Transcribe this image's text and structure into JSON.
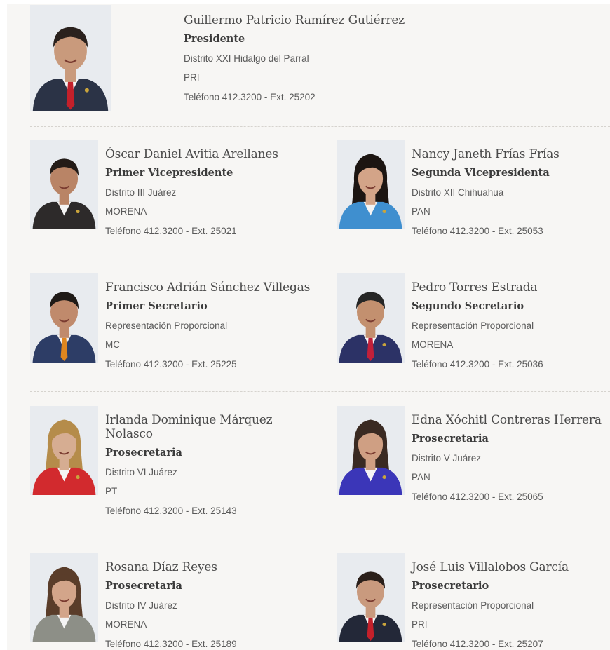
{
  "members": [
    {
      "name": "Guillermo Patricio Ramírez Gutiérrez",
      "role": "Presidente",
      "district": "Distrito XXI Hidalgo del Parral",
      "party": "PRI",
      "phone": "Teléfono 412.3200  -  Ext. 25202",
      "skin": "#c99a7c",
      "hair": "#2a211d",
      "suit": "#2b3346",
      "tie": "#c4202a",
      "gender": "m",
      "pin": true
    },
    {
      "name": "Óscar Daniel Avitia Arellanes",
      "role": "Primer Vicepresidente",
      "district": "Distrito III Juárez",
      "party": "MORENA",
      "phone": "Teléfono 412.3200  -  Ext. 25021",
      "skin": "#b98466",
      "hair": "#231b17",
      "suit": "#2d2a2a",
      "tie": "",
      "gender": "m",
      "pin": true
    },
    {
      "name": "Nancy Janeth Frías Frías",
      "role": "Segunda Vicepresidenta",
      "district": "Distrito XII Chihuahua",
      "party": "PAN",
      "phone": "Teléfono 412.3200  -  Ext. 25053",
      "skin": "#d3a488",
      "hair": "#1c1512",
      "suit": "#3f8fcf",
      "tie": "",
      "gender": "f",
      "pin": true
    },
    {
      "name": "Francisco Adrián Sánchez Villegas",
      "role": "Primer Secretario",
      "district": "Representación Proporcional",
      "party": "MC",
      "phone": "Teléfono 412.3200  -  Ext. 25225",
      "skin": "#c08a6c",
      "hair": "#1f1a17",
      "suit": "#2d3d66",
      "tie": "#e0861f",
      "gender": "m",
      "pin": false
    },
    {
      "name": "Pedro Torres Estrada",
      "role": "Segundo Secretario",
      "district": "Representación Proporcional",
      "party": "MORENA",
      "phone": "Teléfono 412.3200  -  Ext. 25036",
      "skin": "#c3906f",
      "hair": "#262626",
      "suit": "#2c3266",
      "tie": "#c2203a",
      "gender": "m",
      "pin": true
    },
    {
      "name": "Irlanda Dominique Márquez Nolasco",
      "role": "Prosecretaria",
      "district": "Distrito VI Juárez",
      "party": "PT",
      "phone": "Teléfono 412.3200  -  Ext. 25143",
      "skin": "#d6ad92",
      "hair": "#b58c4a",
      "suit": "#d22a2e",
      "tie": "",
      "gender": "f",
      "pin": true
    },
    {
      "name": "Edna Xóchitl Contreras Herrera",
      "role": "Prosecretaria",
      "district": "Distrito V Juárez",
      "party": "PAN",
      "phone": "Teléfono 412.3200  -  Ext. 25065",
      "skin": "#cf9f83",
      "hair": "#3a2a22",
      "suit": "#3b36b8",
      "tie": "",
      "gender": "f",
      "pin": true
    },
    {
      "name": "Rosana Díaz Reyes",
      "role": "Prosecretaria",
      "district": "Distrito IV Juárez",
      "party": "MORENA",
      "phone": "Teléfono 412.3200  -  Ext. 25189",
      "skin": "#d3a58a",
      "hair": "#5a3d2a",
      "suit": "#8d8f87",
      "tie": "",
      "gender": "f",
      "pin": false
    },
    {
      "name": "José Luis Villalobos García",
      "role": "Prosecretario",
      "district": "Representación Proporcional",
      "party": "PRI",
      "phone": "Teléfono 412.3200  -  Ext. 25207",
      "skin": "#c99a7e",
      "hair": "#2a1f1a",
      "suit": "#232838",
      "tie": "#c4202a",
      "gender": "m",
      "pin": true
    }
  ]
}
